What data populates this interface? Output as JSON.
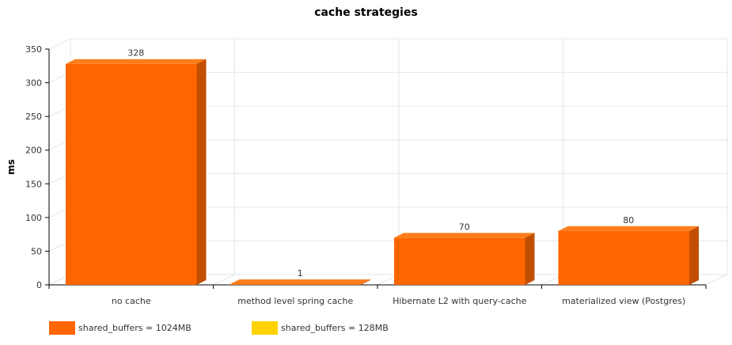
{
  "chart_data": {
    "type": "bar",
    "title": "cache strategies",
    "xlabel": "",
    "ylabel": "ms",
    "ylim": [
      0,
      350
    ],
    "yticks": [
      0,
      50,
      100,
      150,
      200,
      250,
      300,
      350
    ],
    "grid": true,
    "legend_position": "bottom-left",
    "categories": [
      "no cache",
      "method level spring cache",
      "Hibernate L2 with query-cache",
      "materialized view (Postgres)"
    ],
    "series": [
      {
        "name": "shared_buffers = 1024MB",
        "color": "#ff6600",
        "values": [
          328,
          1,
          70,
          80
        ],
        "labels": [
          "328",
          "1",
          "70",
          "80"
        ]
      },
      {
        "name": "shared_buffers = 128MB",
        "color": "#ffd200",
        "values": []
      }
    ]
  }
}
